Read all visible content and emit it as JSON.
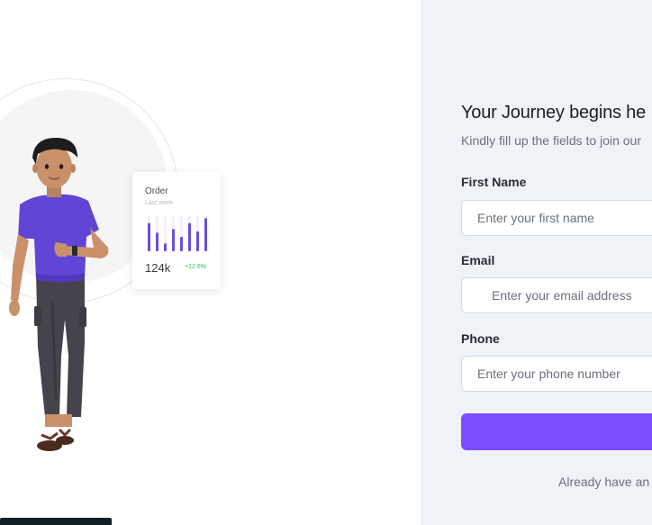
{
  "illustration": {
    "order_card": {
      "title": "Order",
      "subtitle": "Last week",
      "value": "124k",
      "change": "+12.6%",
      "bars": [
        0.78,
        0.52,
        0.22,
        0.62,
        0.4,
        0.78,
        0.55,
        0.92
      ],
      "bar_color": "#6a4fe0",
      "bar_track_color": "#f1f0fb",
      "change_color": "#27c46b"
    }
  },
  "form": {
    "title": "Your Journey begins he",
    "subtitle": "Kindly fill up the fields to join our",
    "fields": [
      {
        "label": "First Name",
        "placeholder": "Enter your first name"
      },
      {
        "label": "Email",
        "placeholder": "Enter your email address"
      },
      {
        "label": "Phone",
        "placeholder": "Enter your phone number"
      }
    ],
    "submit_label": "",
    "footer_text": "Already have an",
    "accent_color": "#7c4dff"
  }
}
